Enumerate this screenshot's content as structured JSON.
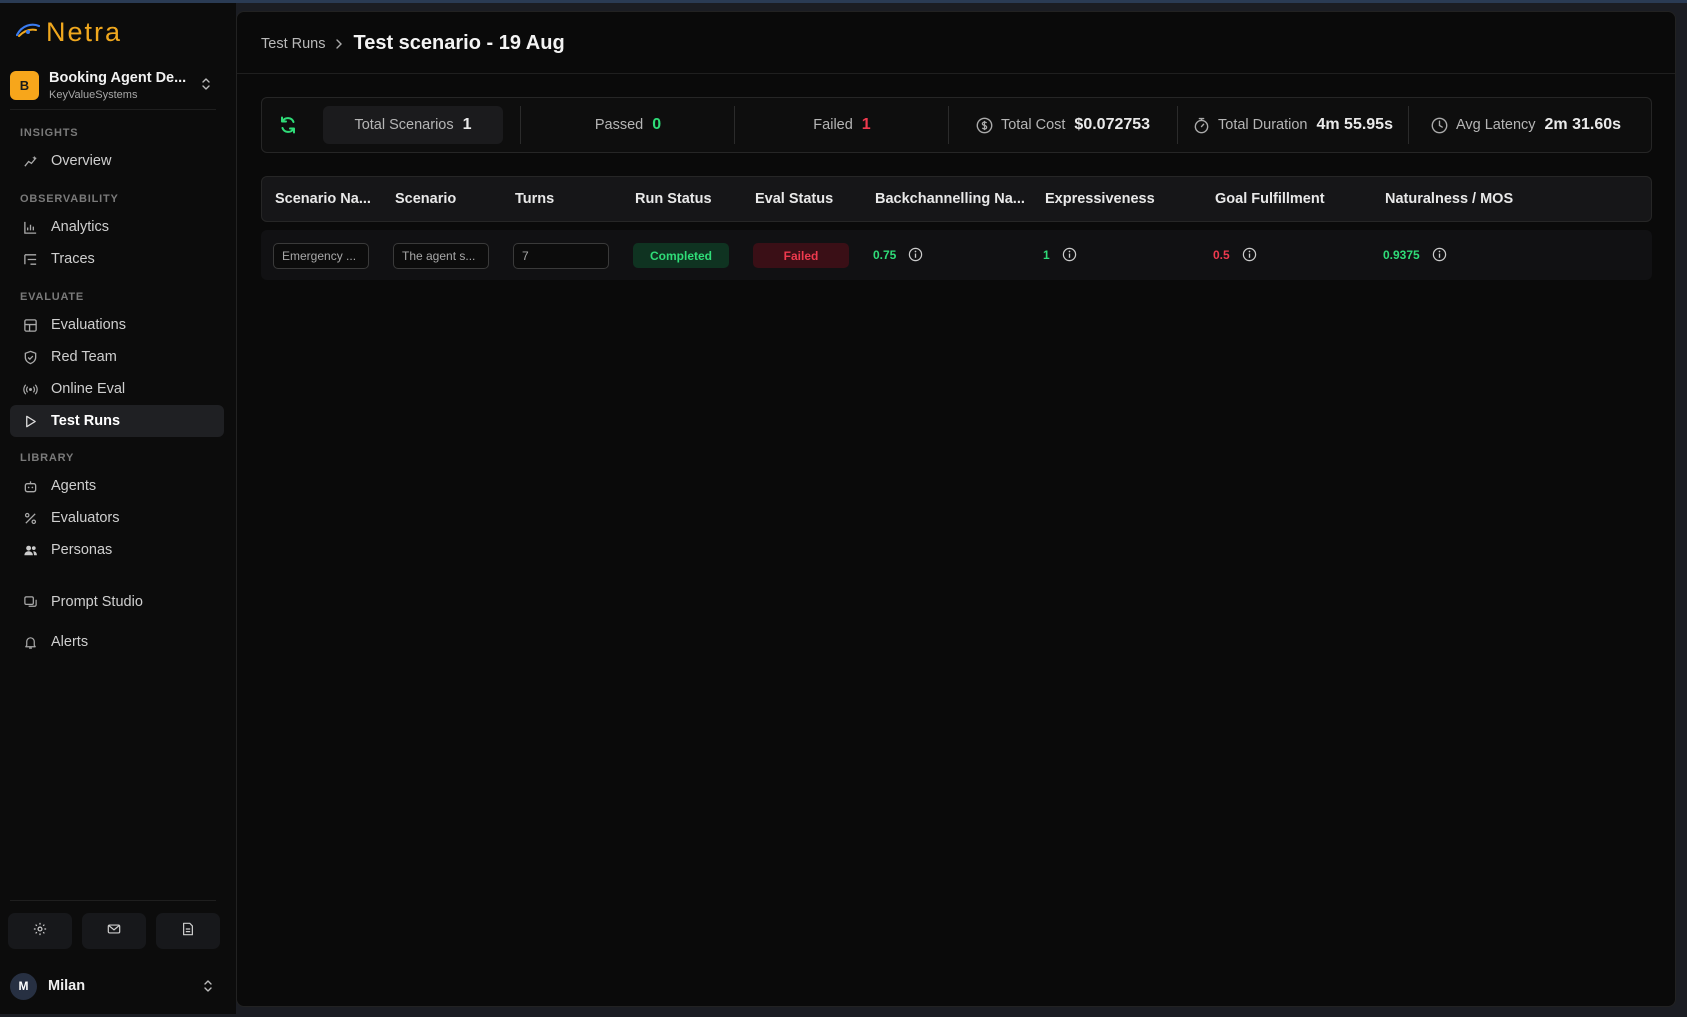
{
  "app": {
    "logo_text": "Netra"
  },
  "project": {
    "initial": "B",
    "name": "Booking Agent De...",
    "org": "KeyValueSystems"
  },
  "sidebar": {
    "sections": {
      "insights": "INSIGHTS",
      "observability": "OBSERVABILITY",
      "evaluate": "EVALUATE",
      "library": "LIBRARY"
    },
    "items": {
      "overview": "Overview",
      "analytics": "Analytics",
      "traces": "Traces",
      "evaluations": "Evaluations",
      "red_team": "Red Team",
      "online_eval": "Online Eval",
      "test_runs": "Test Runs",
      "agents": "Agents",
      "evaluators": "Evaluators",
      "personas": "Personas",
      "prompt_studio": "Prompt Studio",
      "alerts": "Alerts"
    },
    "active": "test_runs"
  },
  "user": {
    "initial": "M",
    "name": "Milan"
  },
  "header": {
    "breadcrumb_parent": "Test Runs",
    "title": "Test scenario - 19 Aug"
  },
  "stats": {
    "total_scenarios_label": "Total Scenarios",
    "total_scenarios": "1",
    "passed_label": "Passed",
    "passed": "0",
    "failed_label": "Failed",
    "failed": "1",
    "total_cost_label": "Total Cost",
    "total_cost": "$0.072753",
    "total_duration_label": "Total Duration",
    "total_duration": "4m 55.95s",
    "avg_latency_label": "Avg Latency",
    "avg_latency": "2m 31.60s"
  },
  "table": {
    "columns": {
      "scenario_name": "Scenario Na...",
      "scenario": "Scenario",
      "turns": "Turns",
      "run_status": "Run Status",
      "eval_status": "Eval Status",
      "backchannelling": "Backchannelling Na...",
      "expressiveness": "Expressiveness",
      "goal_fulfillment": "Goal Fulfillment",
      "naturalness": "Naturalness / MOS"
    },
    "rows": [
      {
        "scenario_name": "Emergency ...",
        "scenario": "The agent s...",
        "turns": "7",
        "run_status": "Completed",
        "eval_status": "Failed",
        "backchannelling": "0.75",
        "expressiveness": "1",
        "goal_fulfillment": "0.5",
        "naturalness": "0.9375"
      }
    ]
  },
  "colors": {
    "accent": "#f0a81e",
    "pass": "#2fdc78",
    "fail": "#ef3a4e",
    "background": "#0a0a0a"
  },
  "icons": {
    "logo": "eye-swoosh-icon",
    "refresh": "refresh-icon",
    "cost": "dollar-circle-icon",
    "duration": "stopwatch-icon",
    "latency": "clock-icon",
    "settings": "gear-icon",
    "mail": "mail-icon",
    "docs": "document-icon"
  }
}
